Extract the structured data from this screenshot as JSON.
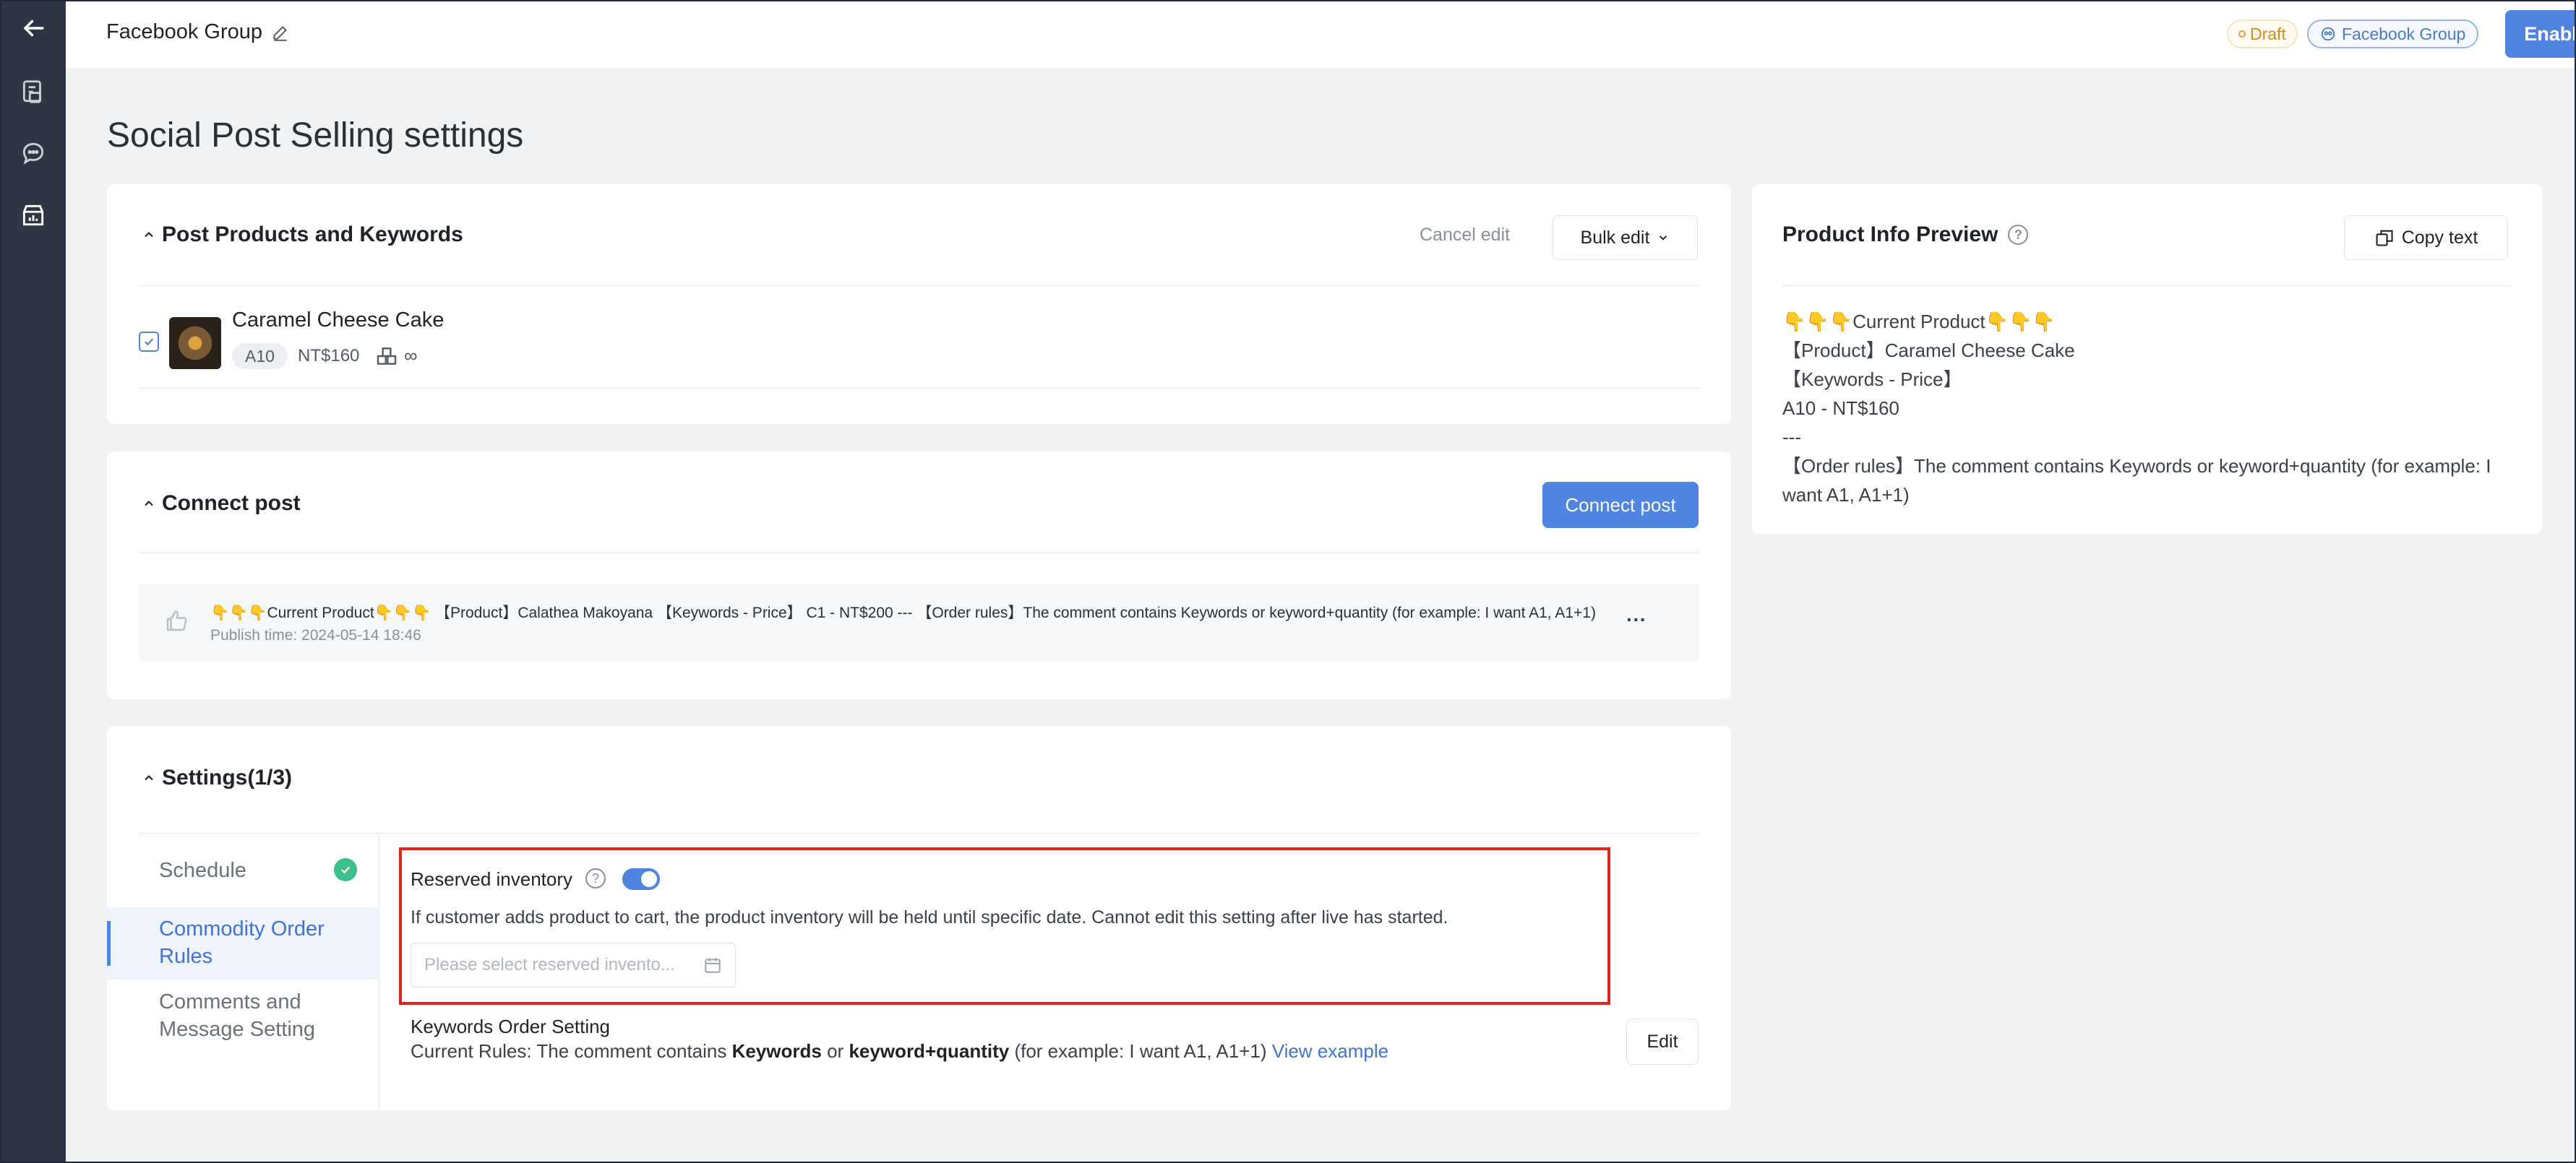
{
  "topbar": {
    "title": "Facebook Group",
    "status_badge": "Draft",
    "channel_badge": "Facebook Group",
    "enable_label": "Enable"
  },
  "page": {
    "title": "Social Post Selling settings"
  },
  "products_card": {
    "title": "Post Products and Keywords",
    "cancel_edit": "Cancel edit",
    "bulk_edit": "Bulk edit",
    "product": {
      "name": "Caramel Cheese Cake",
      "keyword": "A10",
      "price": "NT$160",
      "stock": "∞",
      "checked": true
    }
  },
  "connect_card": {
    "title": "Connect post",
    "connect_button": "Connect post",
    "post": {
      "text": "👇👇👇Current Product👇👇👇 【Product】Calathea Makoyana 【Keywords - Price】 C1 - NT$200 --- 【Order rules】The comment contains Keywords or keyword+quantity (for example: I want A1, A1+1)",
      "publish_time": "Publish time: 2024-05-14 18:46",
      "more": "···"
    }
  },
  "settings_card": {
    "title": "Settings(1/3)",
    "nav": [
      {
        "label": "Schedule",
        "done": true
      },
      {
        "label": "Commodity Order Rules",
        "active": true
      },
      {
        "label": "Comments and Message Setting"
      }
    ],
    "reserved": {
      "label": "Reserved inventory",
      "enabled": true,
      "description": "If customer adds product to cart, the product inventory will be held until specific date. Cannot edit this setting after live has started.",
      "placeholder": "Please select reserved invento..."
    },
    "keywords": {
      "label": "Keywords Order Setting",
      "rules_prefix": "Current Rules: The comment contains ",
      "kw": "Keywords",
      "or": " or ",
      "kwq": "keyword+quantity",
      "example": " (for example: I want A1, A1+1) ",
      "view_example": "View example",
      "edit": "Edit"
    }
  },
  "preview_card": {
    "title": "Product Info Preview",
    "copy_text": "Copy text",
    "lines": [
      "👇👇👇Current Product👇👇👇",
      "【Product】Caramel Cheese Cake",
      "【Keywords - Price】",
      "A10 - NT$160",
      "---",
      "【Order rules】The comment contains Keywords or keyword+quantity (for example: I want A1, A1+1)"
    ]
  },
  "colors": {
    "accent": "#4f84e0",
    "rail": "#2f3542",
    "highlight_border": "#e3241b",
    "success": "#3cc08a"
  }
}
